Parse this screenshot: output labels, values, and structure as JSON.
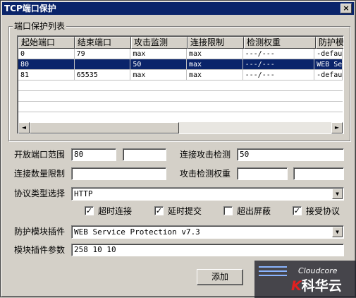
{
  "window": {
    "title": "TCP端口保护",
    "close_glyph": "×"
  },
  "group": {
    "title": "端口保护列表"
  },
  "table": {
    "columns": [
      "起始端口",
      "结束端口",
      "攻击监测",
      "连接限制",
      "检测权重",
      "防护模"
    ],
    "rows": [
      [
        "0",
        "79",
        "max",
        "max",
        "---/---",
        "-defaul"
      ],
      [
        "80",
        "",
        "50",
        "max",
        "---/---",
        "WEB Ser"
      ],
      [
        "81",
        "65535",
        "max",
        "max",
        "---/---",
        "-defaul"
      ]
    ],
    "selected_row": 1,
    "scroll_left_glyph": "◄",
    "scroll_right_glyph": "►"
  },
  "form": {
    "open_port_range_label": "开放端口范围",
    "open_port_from": "80",
    "open_port_to": "",
    "conn_attack_detect_label": "连接攻击检测",
    "conn_attack_detect_value": "50",
    "conn_limit_label": "连接数量限制",
    "conn_limit_value": "",
    "attack_weight_label": "攻击检测权重",
    "attack_weight_a": "",
    "attack_weight_b": "",
    "protocol_label": "协议类型选择",
    "protocol_value": "HTTP",
    "checkboxes": [
      {
        "label": "超时连接",
        "checked": true,
        "mark": "✓"
      },
      {
        "label": "延时提交",
        "checked": true,
        "mark": "✓"
      },
      {
        "label": "超出屏蔽",
        "checked": false,
        "mark": ""
      },
      {
        "label": "接受协议",
        "checked": true,
        "mark": "✓"
      }
    ],
    "plugin_label": "防护模块插件",
    "plugin_value": "WEB Service Protection v7.3",
    "plugin_params_label": "模块插件参数",
    "plugin_params_value": "258 10 10",
    "dropdown_glyph": "▼"
  },
  "buttons": {
    "add_label": "添加"
  },
  "watermark": {
    "brand": "Cloudcore",
    "k_letter": "K",
    "logo_text": "科华云"
  }
}
